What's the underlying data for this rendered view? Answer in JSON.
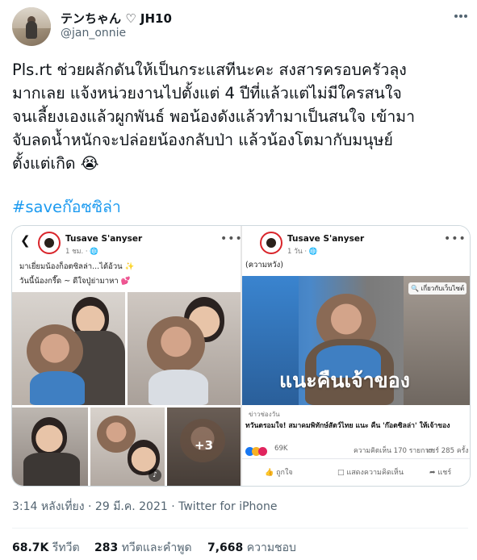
{
  "author": {
    "display_name": "テンちゃん ♡ JH10",
    "handle": "@jan_onnie"
  },
  "tweet": {
    "lines": [
      "Pls.rt ช่วยผลักดันให้เป็นกระแสทีนะคะ สงสารครอบครัวลุง",
      "มากเลย แจ้งหน่วยงานไปตั้งแต่ 4 ปีที่แล้วแต่ไม่มีใครสนใจ",
      "จนเลี้ยงเองแล้วผูกพันธ์ พอน้องดังแล้วทำมาเป็นสนใจ เข้ามา",
      "จับลดน้ำหนักจะปล่อยน้องกลับป่า แล้วน้องโตมากับมนุษย์",
      "ตั้งแต่เกิด 😭"
    ],
    "hashtag": "#saveก๊อซซิล่า"
  },
  "media": {
    "left": {
      "page_name": "Tusave S'anyser",
      "post_time": "1 ชม. · 🌐",
      "caption_line1": "มาเยี่ยมน้องก็อตซิลล่า...ได้อ้วน ✨",
      "caption_line2": "วันนี้น้องกรี๊ด ~ ดีใจปู่ย่ามาหา 💕",
      "more_count": "+3"
    },
    "right": {
      "page_name": "Tusave S'anyser",
      "post_time": "1 วัน · 🌐",
      "caption": "(ความหวัง)",
      "photo_tag": "🔍 เกี่ยวกับเว็บไซต์",
      "overlay_text": "แนะคืนเจ้าของ",
      "link_source": "ข่าวช่องวัน",
      "link_title": "ทวันตรอมใจ! สมาคมพิทักษ์สัตว์ไทย แนะ คืน 'ก๊อตซิลล่า' ให้เจ้าของ",
      "reactions_count": "69K",
      "comments_count": "ความคิดเห็น 170 รายการ",
      "shares_count": "แชร์ 285 ครั้ง",
      "like_label": "ถูกใจ",
      "comment_label": "แสดงความคิดเห็น",
      "share_label": "แชร์"
    }
  },
  "meta": {
    "timestamp": "3:14 หลังเที่ยง · 29 มี.ค. 2021 · Twitter for iPhone"
  },
  "stats": {
    "retweets_value": "68.7K",
    "retweets_label": "รีทวีต",
    "quotes_value": "283",
    "quotes_label": "ทวีตและคำพูด",
    "likes_value": "7,668",
    "likes_label": "ความชอบ"
  },
  "colors": {
    "link_blue": "#1d9bf0",
    "muted": "#536471",
    "border": "#cfd9de"
  }
}
